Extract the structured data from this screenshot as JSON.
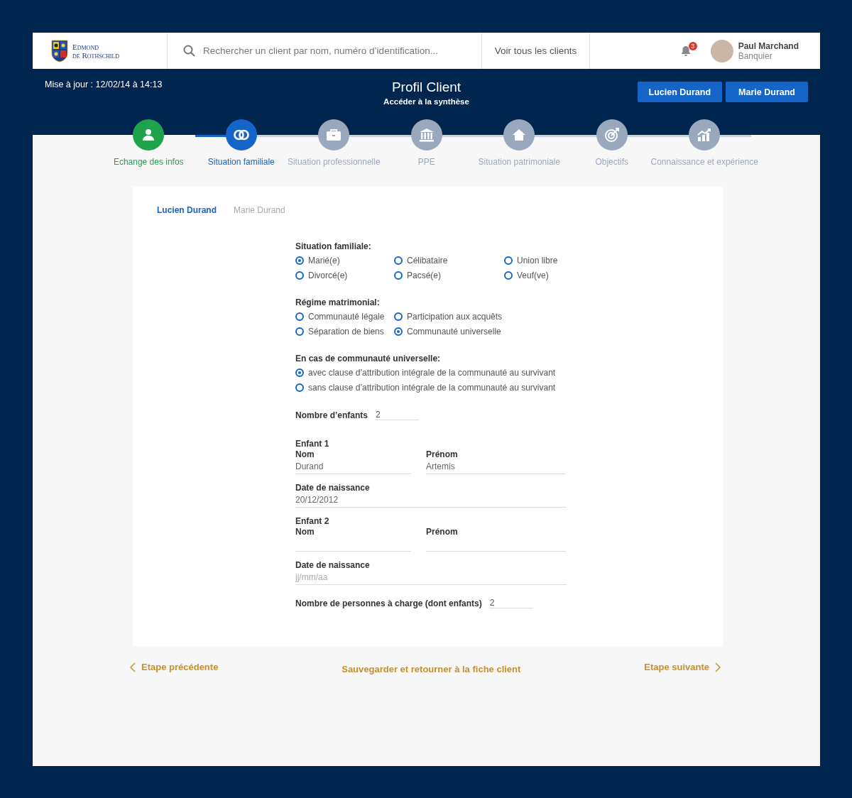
{
  "header": {
    "logo_line1": "Edmond",
    "logo_line2": "de Rothschild",
    "search": {
      "placeholder": "Rechercher un client par nom, numéro d’identification..."
    },
    "all_clients_link": "Voir tous les clients",
    "notifications": {
      "count": "3"
    },
    "user": {
      "name": "Paul Marchand",
      "role": "Banquier"
    }
  },
  "banner": {
    "updated": "Mise à jour : 12/02/14 à 14:13",
    "title": "Profil Client",
    "summary_link": "Accéder à la synthèse",
    "client_buttons": [
      "Lucien Durand",
      "Marie Durand"
    ]
  },
  "steps": [
    {
      "label": "Echange des infos",
      "completed": true,
      "selected": false,
      "kind": "person"
    },
    {
      "label": "Situation familiale",
      "completed": false,
      "selected": true,
      "kind": "rings"
    },
    {
      "label": "Situation professionnelle",
      "completed": false,
      "selected": false,
      "kind": "briefcase"
    },
    {
      "label": "PPE",
      "completed": false,
      "selected": false,
      "kind": "bank"
    },
    {
      "label": "Situation patrimoniale",
      "completed": false,
      "selected": false,
      "kind": "house"
    },
    {
      "label": "Objectifs",
      "completed": false,
      "selected": false,
      "kind": "target"
    },
    {
      "label": "Connaissance et expérience",
      "completed": false,
      "selected": false,
      "kind": "chart"
    }
  ],
  "person_tabs": [
    {
      "label": "Lucien Durand",
      "selected": true
    },
    {
      "label": "Marie Durand",
      "selected": false
    }
  ],
  "radio_groups": [
    {
      "title": "Situation familiale:",
      "options": [
        {
          "label": "Marié(e)",
          "selected": true
        },
        {
          "label": "Célibataire",
          "selected": false
        },
        {
          "label": "Union libre",
          "selected": false
        },
        {
          "label": "Divorcé(e)",
          "selected": false
        },
        {
          "label": "Pacsé(e)",
          "selected": false
        },
        {
          "label": "Veuf(ve)",
          "selected": false
        }
      ]
    },
    {
      "title": "Régime matrimonial:",
      "options": [
        {
          "label": "Communauté légale",
          "selected": false
        },
        {
          "label": "Participation aux acquêts",
          "selected": false
        },
        {
          "label": "Séparation de biens",
          "selected": false
        },
        {
          "label": "Communauté universelle",
          "selected": true
        }
      ]
    },
    {
      "title": "En cas de communauté universelle:",
      "options": [
        {
          "label": "avec clause d’attribution intégrale  de la communauté au survivant",
          "selected": true
        },
        {
          "label": "sans clause d’attribution intégrale de la communauté au survivant",
          "selected": false
        }
      ]
    }
  ],
  "children_count": {
    "label": "Nombre d’enfants",
    "value": "2"
  },
  "children": [
    {
      "title": "Enfant 1",
      "last_name": {
        "label": "Nom",
        "value": "Durand"
      },
      "first_name": {
        "label": "Prénom",
        "value": "Artemis"
      },
      "birth_date": {
        "label": "Date de naissance",
        "value": "20/12/2012"
      }
    },
    {
      "title": "Enfant 2",
      "last_name": {
        "label": "Nom"
      },
      "first_name": {
        "label": "Prénom"
      },
      "birth_date": {
        "label": "Date de naissance",
        "placeholder": "jj/mm/aa"
      }
    }
  ],
  "dependents": {
    "label": "Nombre de personnes à charge (dont enfants)",
    "value": "2"
  },
  "footer": {
    "previous": "Etape précédente",
    "save": "Sauvegarder et retourner à la fiche client",
    "next": "Etape suivante"
  }
}
